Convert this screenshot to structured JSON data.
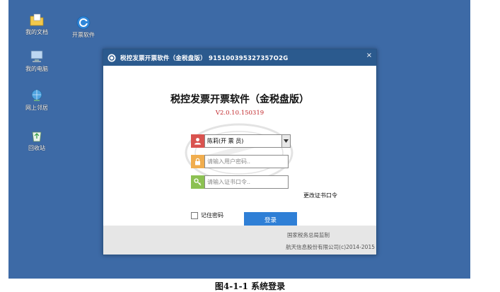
{
  "desktop": {
    "icons": [
      {
        "label": "我的文档",
        "icon": "folder-documents-icon"
      },
      {
        "label": "开票软件",
        "icon": "invoice-app-icon"
      },
      {
        "label": "我的电脑",
        "icon": "computer-icon"
      },
      {
        "label": "网上邻居",
        "icon": "network-icon"
      },
      {
        "label": "回收站",
        "icon": "recycle-bin-icon"
      }
    ]
  },
  "window": {
    "title": "税控发票开票软件（金税盘版） 915100395327357O2G",
    "close_label": "×",
    "app_title": "税控发票开票软件（金税盘版）",
    "version": "V2.0.10.150319",
    "user_select": {
      "value": "陈莉(开 票 员)"
    },
    "password_input": {
      "placeholder": "请输入用户密码.."
    },
    "cert_input": {
      "placeholder": "请输入证书口令.."
    },
    "change_cert_link": "更改证书口令",
    "remember_label": "记住密码",
    "login_label": "登录",
    "footer_line1": "国家税务总局监制",
    "footer_line2": "航天信息股份有限公司(c)2014-2015"
  },
  "caption": "图4-1-1  系统登录",
  "colors": {
    "desktop": "#3d6aa6",
    "titlebar": "#2b5a8e",
    "login_button": "#2f7fd6",
    "version_red": "#c0262a"
  }
}
